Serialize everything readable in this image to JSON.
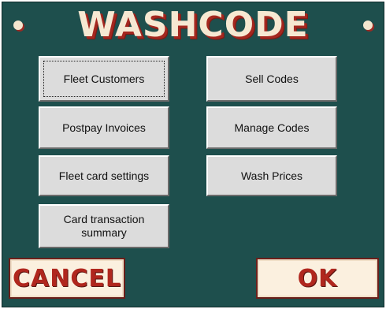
{
  "app": {
    "title": "WASHCODE"
  },
  "menu": {
    "fleet_customers": "Fleet Customers",
    "sell_codes": "Sell Codes",
    "postpay_invoices": "Postpay Invoices",
    "manage_codes": "Manage Codes",
    "fleet_card_settings": "Fleet card settings",
    "wash_prices": "Wash Prices",
    "card_transaction_summary": "Card transaction summary"
  },
  "actions": {
    "cancel": "CANCEL",
    "ok": "OK"
  },
  "colors": {
    "background": "#1e4f4d",
    "title_fill": "#f6e8d2",
    "title_shadow": "#a4271f",
    "action_text": "#b0271e"
  }
}
